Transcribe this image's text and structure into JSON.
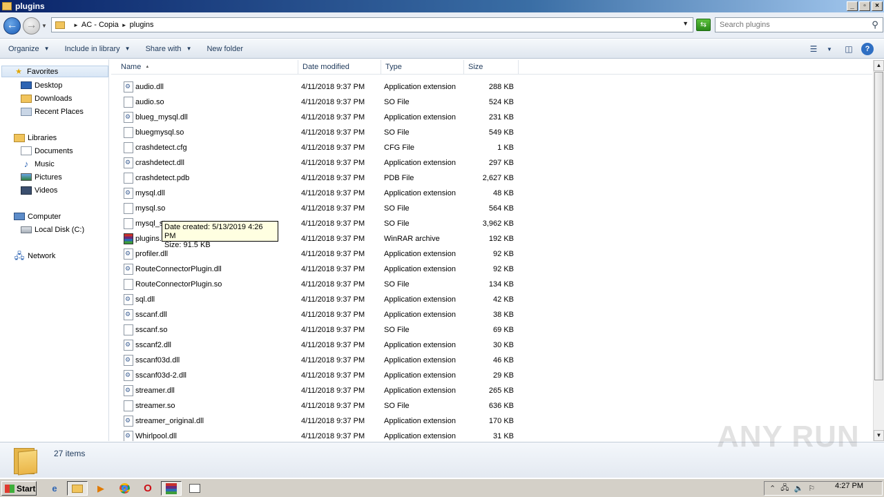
{
  "window": {
    "title": "plugins"
  },
  "address": {
    "crumbs": [
      "AC - Copia",
      "plugins"
    ],
    "search_placeholder": "Search plugins"
  },
  "toolbar": {
    "organize": "Organize",
    "include_in_library": "Include in library",
    "share_with": "Share with",
    "new_folder": "New folder"
  },
  "nav": {
    "favorites": "Favorites",
    "desktop": "Desktop",
    "downloads": "Downloads",
    "recent_places": "Recent Places",
    "libraries": "Libraries",
    "documents": "Documents",
    "music": "Music",
    "pictures": "Pictures",
    "videos": "Videos",
    "computer": "Computer",
    "local_disk": "Local Disk (C:)",
    "network": "Network"
  },
  "columns": {
    "name": "Name",
    "date": "Date modified",
    "type": "Type",
    "size": "Size"
  },
  "files": [
    {
      "name": "audio.dll",
      "date": "4/11/2018 9:37 PM",
      "type": "Application extension",
      "size": "288 KB",
      "icon": "dll-icon"
    },
    {
      "name": "audio.so",
      "date": "4/11/2018 9:37 PM",
      "type": "SO File",
      "size": "524 KB",
      "icon": "file-icon"
    },
    {
      "name": "blueg_mysql.dll",
      "date": "4/11/2018 9:37 PM",
      "type": "Application extension",
      "size": "231 KB",
      "icon": "dll-icon"
    },
    {
      "name": "bluegmysql.so",
      "date": "4/11/2018 9:37 PM",
      "type": "SO File",
      "size": "549 KB",
      "icon": "file-icon"
    },
    {
      "name": "crashdetect.cfg",
      "date": "4/11/2018 9:37 PM",
      "type": "CFG File",
      "size": "1 KB",
      "icon": "file-icon"
    },
    {
      "name": "crashdetect.dll",
      "date": "4/11/2018 9:37 PM",
      "type": "Application extension",
      "size": "297 KB",
      "icon": "dll-icon"
    },
    {
      "name": "crashdetect.pdb",
      "date": "4/11/2018 9:37 PM",
      "type": "PDB File",
      "size": "2,627 KB",
      "icon": "file-icon"
    },
    {
      "name": "mysql.dll",
      "date": "4/11/2018 9:37 PM",
      "type": "Application extension",
      "size": "48 KB",
      "icon": "dll-icon"
    },
    {
      "name": "mysql.so",
      "date": "4/11/2018 9:37 PM",
      "type": "SO File",
      "size": "564 KB",
      "icon": "file-icon"
    },
    {
      "name": "mysql_st",
      "date": "4/11/2018 9:37 PM",
      "type": "SO File",
      "size": "3,962 KB",
      "icon": "file-icon"
    },
    {
      "name": "plugins.r",
      "date": "4/11/2018 9:37 PM",
      "type": "WinRAR archive",
      "size": "192 KB",
      "icon": "rar-icon"
    },
    {
      "name": "profiler.dll",
      "date": "4/11/2018 9:37 PM",
      "type": "Application extension",
      "size": "92 KB",
      "icon": "dll-icon"
    },
    {
      "name": "RouteConnectorPlugin.dll",
      "date": "4/11/2018 9:37 PM",
      "type": "Application extension",
      "size": "92 KB",
      "icon": "dll-icon"
    },
    {
      "name": "RouteConnectorPlugin.so",
      "date": "4/11/2018 9:37 PM",
      "type": "SO File",
      "size": "134 KB",
      "icon": "file-icon"
    },
    {
      "name": "sql.dll",
      "date": "4/11/2018 9:37 PM",
      "type": "Application extension",
      "size": "42 KB",
      "icon": "dll-icon"
    },
    {
      "name": "sscanf.dll",
      "date": "4/11/2018 9:37 PM",
      "type": "Application extension",
      "size": "38 KB",
      "icon": "dll-icon"
    },
    {
      "name": "sscanf.so",
      "date": "4/11/2018 9:37 PM",
      "type": "SO File",
      "size": "69 KB",
      "icon": "file-icon"
    },
    {
      "name": "sscanf2.dll",
      "date": "4/11/2018 9:37 PM",
      "type": "Application extension",
      "size": "30 KB",
      "icon": "dll-icon"
    },
    {
      "name": "sscanf03d.dll",
      "date": "4/11/2018 9:37 PM",
      "type": "Application extension",
      "size": "46 KB",
      "icon": "dll-icon"
    },
    {
      "name": "sscanf03d-2.dll",
      "date": "4/11/2018 9:37 PM",
      "type": "Application extension",
      "size": "29 KB",
      "icon": "dll-icon"
    },
    {
      "name": "streamer.dll",
      "date": "4/11/2018 9:37 PM",
      "type": "Application extension",
      "size": "265 KB",
      "icon": "dll-icon"
    },
    {
      "name": "streamer.so",
      "date": "4/11/2018 9:37 PM",
      "type": "SO File",
      "size": "636 KB",
      "icon": "file-icon"
    },
    {
      "name": "streamer_original.dll",
      "date": "4/11/2018 9:37 PM",
      "type": "Application extension",
      "size": "170 KB",
      "icon": "dll-icon"
    },
    {
      "name": "Whirlpool.dll",
      "date": "4/11/2018 9:37 PM",
      "type": "Application extension",
      "size": "31 KB",
      "icon": "dll-icon"
    }
  ],
  "tooltip": {
    "line1": "Date created: 5/13/2019 4:26 PM",
    "line2": "Size: 91.5 KB"
  },
  "details": {
    "count": "27 items"
  },
  "watermark": "ANY RUN",
  "taskbar": {
    "start": "Start",
    "clock": "4:27 PM"
  }
}
